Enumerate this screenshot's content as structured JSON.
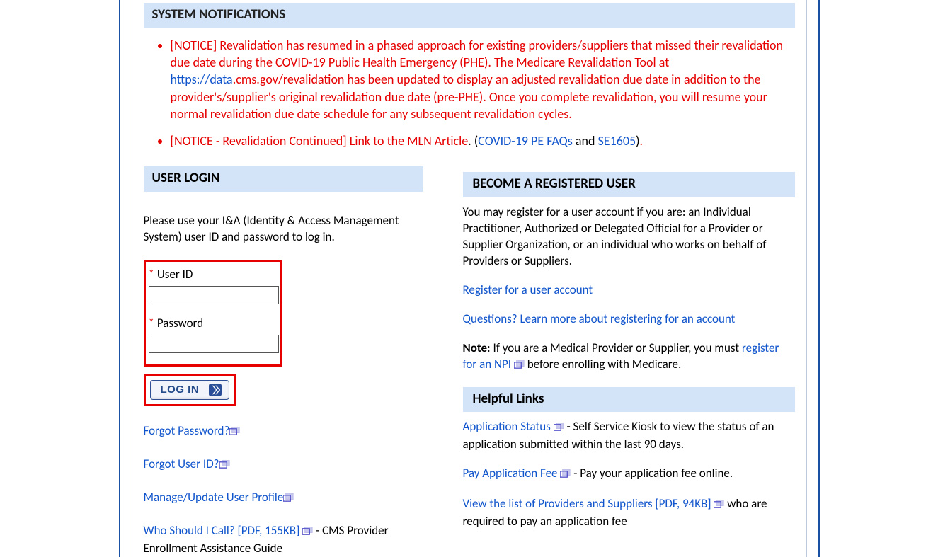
{
  "notifications_header": "SYSTEM NOTIFICATIONS",
  "notifications": [
    {
      "prefix": "[NOTICE] Revalidation has resumed in a phased approach for existing providers/suppliers that missed their revalidation due date during the COVID-19 Public Health Emergency (PHE). The Medicare Revalidation Tool at ",
      "link1_text": "https://data",
      "link1_plain": ".cms.gov/revalidation",
      "suffix": " has been updated to display an adjusted revalidation due date in addition to the provider's/supplier's original revalidation due date (pre-PHE). Once you complete revalidation, you will resume your normal revalidation due date schedule for any subsequent revalidation cycles."
    },
    {
      "prefix": "[NOTICE - Revalidation Continued] Link to the MLN Article",
      "dot_open": ". (",
      "link2": "COVID-19 PE FAQs",
      "and": " and ",
      "link3": "SE1605",
      "close": ")",
      "period": "."
    }
  ],
  "login": {
    "header": "USER LOGIN",
    "instructions": "Please use your I&A (Identity & Access Management System) user ID and password to log in.",
    "user_id_label": "User ID",
    "password_label": "Password",
    "login_button": "LOG IN",
    "links": {
      "forgot_password": "Forgot Password?",
      "forgot_user_id": "Forgot User ID?",
      "manage_profile": "Manage/Update User Profile",
      "who_should_i_call": "Who Should I Call? [PDF, 155KB]",
      "who_should_i_call_desc": " - CMS Provider Enrollment Assistance Guide"
    }
  },
  "register": {
    "header": "BECOME A REGISTERED USER",
    "intro": "You may register for a user account if you are: an Individual Practitioner, Authorized or Delegated Official for a Provider or Supplier Organization, or an individual who works on behalf of Providers or Suppliers.",
    "register_link": "Register for a user account",
    "questions_link": "Questions? Learn more about registering for an account",
    "note_label": "Note",
    "note_text1": ": If you are a Medical Provider or Supplier, you must ",
    "npi_link": "register for an NPI",
    "note_text2": " before enrolling with Medicare."
  },
  "helpful": {
    "header": "Helpful Links",
    "items": [
      {
        "link": "Application Status",
        "desc": " - Self Service Kiosk to view the status of an application submitted within the last 90 days.",
        "ext": true
      },
      {
        "link": "Pay Application Fee",
        "desc": " - Pay your application fee online.",
        "ext": true
      },
      {
        "link": "View the list of Providers and Suppliers [PDF, 94KB]",
        "desc": " who are required to pay an application fee",
        "ext": true
      }
    ]
  }
}
